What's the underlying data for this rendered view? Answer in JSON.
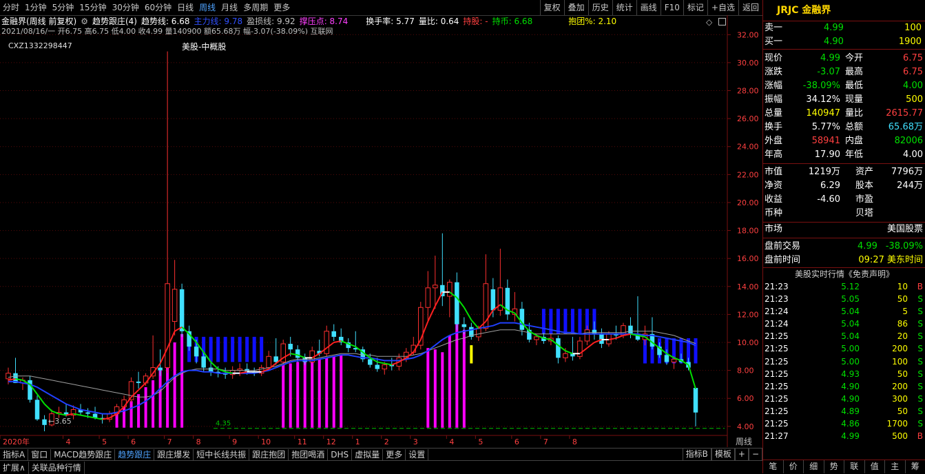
{
  "toolbar": {
    "periods": [
      "分时",
      "1分钟",
      "5分钟",
      "15分钟",
      "30分钟",
      "60分钟",
      "日线",
      "周线",
      "月线",
      "多周期",
      "更多"
    ],
    "active_period": "周线",
    "right_buttons": [
      "复权",
      "叠加",
      "历史",
      "统计",
      "画线",
      "F10",
      "标记",
      "+自选",
      "返回"
    ]
  },
  "info": {
    "stock_line": "金融界(周线 前复权)",
    "indicator_name": "趋势跟庄(4)",
    "trend_label": "趋势线: 6.68",
    "main_label": "主力线: 9.78",
    "profit_label": "盈损线: 9.92",
    "press_label": "撑压点: 8.74",
    "turnover_label": "换手率: 5.77",
    "vol_ratio_label": "量比: 0.64",
    "hold_label": "持股: -",
    "hold_coin_label": "持币: 6.68",
    "group_label": "抱团%: 2.10",
    "ohlc_line": "2021/08/16/一 开6.75 高6.75 低4.00 收4.99 量140900 额65.68万 幅-3.07(-38.09%) 互联网",
    "code": "CXZ1332298447",
    "annotation": "美股-中概股",
    "low_marker": "3.65",
    "support_label": "4.35"
  },
  "chart_data": {
    "type": "candlestick",
    "title": "",
    "xlabel": "",
    "ylabel": "",
    "ylim": [
      3.5,
      33.0
    ],
    "yticks": [
      "32.00",
      "30.00",
      "28.00",
      "26.00",
      "24.00",
      "22.00",
      "20.00",
      "18.00",
      "16.00",
      "14.00",
      "12.00",
      "10.00",
      "8.00",
      "6.00",
      "4.00"
    ],
    "xticks": [
      "2020年",
      "4",
      "5",
      "6",
      "7",
      "8",
      "9",
      "10",
      "11",
      "12",
      "1",
      "2",
      "3",
      "4",
      "5",
      "6",
      "7",
      "8"
    ],
    "period_label": "周线",
    "support_value": 4.35,
    "candles": [
      [
        7.4,
        8.2,
        7.0,
        7.8
      ],
      [
        7.8,
        8.9,
        7.2,
        7.1
      ],
      [
        7.1,
        7.5,
        6.6,
        7.3
      ],
      [
        7.3,
        7.6,
        5.7,
        5.9
      ],
      [
        5.9,
        6.2,
        4.4,
        4.5
      ],
      [
        4.5,
        4.8,
        3.65,
        4.1
      ],
      [
        4.1,
        5.2,
        4.0,
        4.9
      ],
      [
        4.9,
        5.4,
        4.6,
        5.0
      ],
      [
        5.0,
        5.6,
        4.7,
        4.8
      ],
      [
        4.8,
        5.5,
        4.5,
        5.2
      ],
      [
        5.2,
        5.6,
        4.8,
        5.0
      ],
      [
        5.0,
        5.3,
        4.6,
        4.9
      ],
      [
        4.9,
        5.4,
        4.5,
        4.6
      ],
      [
        4.6,
        4.9,
        4.2,
        4.5
      ],
      [
        4.5,
        5.1,
        4.3,
        4.9
      ],
      [
        4.9,
        5.6,
        4.7,
        5.4
      ],
      [
        5.4,
        6.2,
        5.2,
        5.9
      ],
      [
        5.9,
        7.5,
        5.7,
        7.2
      ],
      [
        7.2,
        7.9,
        6.7,
        7.1
      ],
      [
        7.1,
        7.8,
        6.9,
        7.6
      ],
      [
        7.6,
        10.5,
        7.4,
        8.2
      ],
      [
        8.2,
        9.5,
        7.6,
        8.0
      ],
      [
        8.2,
        30.8,
        7.8,
        14.2
      ],
      [
        11.5,
        15.9,
        10.5,
        13.8
      ],
      [
        13.8,
        14.2,
        10.4,
        10.8
      ],
      [
        10.8,
        11.2,
        9.4,
        9.7
      ],
      [
        9.7,
        10.2,
        8.5,
        9.0
      ],
      [
        9.0,
        9.3,
        7.9,
        8.2
      ],
      [
        8.2,
        8.6,
        7.6,
        7.9
      ],
      [
        7.9,
        8.3,
        7.5,
        7.8
      ],
      [
        7.8,
        8.2,
        7.4,
        7.7
      ],
      [
        7.7,
        8.3,
        7.4,
        8.0
      ],
      [
        8.0,
        8.5,
        7.6,
        8.1
      ],
      [
        8.1,
        8.5,
        7.7,
        7.9
      ],
      [
        7.9,
        8.2,
        7.6,
        7.8
      ],
      [
        7.8,
        8.4,
        7.6,
        8.2
      ],
      [
        8.2,
        9.4,
        8.0,
        9.0
      ],
      [
        9.0,
        10.3,
        8.4,
        8.6
      ],
      [
        8.6,
        10.2,
        8.3,
        9.9
      ],
      [
        9.9,
        10.4,
        9.0,
        9.5
      ],
      [
        9.5,
        9.8,
        8.6,
        8.9
      ],
      [
        8.9,
        9.2,
        8.4,
        8.6
      ],
      [
        8.6,
        9.7,
        8.5,
        9.4
      ],
      [
        9.4,
        10.2,
        9.0,
        9.2
      ],
      [
        9.2,
        11.2,
        9.0,
        10.8
      ],
      [
        10.8,
        11.3,
        10.1,
        10.4
      ],
      [
        10.4,
        11.0,
        9.8,
        10.0
      ],
      [
        10.0,
        10.3,
        9.3,
        9.6
      ],
      [
        9.6,
        10.8,
        9.3,
        9.5
      ],
      [
        9.5,
        9.7,
        8.6,
        8.8
      ],
      [
        8.8,
        9.2,
        8.2,
        8.4
      ],
      [
        8.4,
        8.9,
        7.9,
        8.1
      ],
      [
        8.1,
        8.6,
        7.7,
        8.4
      ],
      [
        8.4,
        8.9,
        8.0,
        8.3
      ],
      [
        8.3,
        9.2,
        8.0,
        8.9
      ],
      [
        8.9,
        9.6,
        8.6,
        9.3
      ],
      [
        9.3,
        10.4,
        9.1,
        9.8
      ],
      [
        9.8,
        12.9,
        9.5,
        12.5
      ],
      [
        12.5,
        15.1,
        11.5,
        13.9
      ],
      [
        13.9,
        16.2,
        12.4,
        14.1
      ],
      [
        14.1,
        17.8,
        12.6,
        13.3
      ],
      [
        13.3,
        14.5,
        11.8,
        14.3
      ],
      [
        14.3,
        15.0,
        10.9,
        11.3
      ],
      [
        11.3,
        11.8,
        10.6,
        11.1
      ],
      [
        11.1,
        11.4,
        10.2,
        10.4
      ],
      [
        10.4,
        11.2,
        10.1,
        11.0
      ],
      [
        11.0,
        16.3,
        10.8,
        14.2
      ],
      [
        13.8,
        14.6,
        11.8,
        12.3
      ],
      [
        12.3,
        16.7,
        11.9,
        13.9
      ],
      [
        13.9,
        14.5,
        11.6,
        12.0
      ],
      [
        12.0,
        13.6,
        11.5,
        12.4
      ],
      [
        12.4,
        12.9,
        10.5,
        10.9
      ],
      [
        10.9,
        11.4,
        10.0,
        10.2
      ],
      [
        10.2,
        10.6,
        9.8,
        10.4
      ],
      [
        10.4,
        10.7,
        9.9,
        10.1
      ],
      [
        10.1,
        10.6,
        9.8,
        10.3
      ],
      [
        10.3,
        10.5,
        8.5,
        8.9
      ],
      [
        8.9,
        9.6,
        8.6,
        9.2
      ],
      [
        9.2,
        10.4,
        8.7,
        9.0
      ],
      [
        9.0,
        10.4,
        8.8,
        10.1
      ],
      [
        10.1,
        11.2,
        9.8,
        10.9
      ],
      [
        10.9,
        11.5,
        10.2,
        10.6
      ],
      [
        10.6,
        11.0,
        9.6,
        9.9
      ],
      [
        9.9,
        10.8,
        9.7,
        10.6
      ],
      [
        10.6,
        11.2,
        10.2,
        10.5
      ],
      [
        10.5,
        11.4,
        10.3,
        11.2
      ],
      [
        11.2,
        11.8,
        10.3,
        10.6
      ],
      [
        10.6,
        13.3,
        10.1,
        10.2
      ],
      [
        10.2,
        11.2,
        9.8,
        10.6
      ],
      [
        10.6,
        11.8,
        9.5,
        9.7
      ],
      [
        9.7,
        10.0,
        8.9,
        9.1
      ],
      [
        9.1,
        9.5,
        8.4,
        8.6
      ],
      [
        8.6,
        9.0,
        8.1,
        8.8
      ],
      [
        8.8,
        9.2,
        8.5,
        8.6
      ],
      [
        8.6,
        8.9,
        8.0,
        8.2
      ],
      [
        6.75,
        6.75,
        4.0,
        4.99
      ]
    ],
    "trend_line": [
      7.3,
      7.4,
      7.3,
      7.0,
      6.3,
      5.6,
      5.1,
      4.9,
      4.8,
      4.9,
      4.8,
      4.7,
      4.6,
      4.5,
      4.6,
      4.9,
      5.4,
      6.1,
      6.6,
      7.1,
      7.8,
      8.5,
      9.6,
      10.8,
      11.1,
      10.6,
      10.0,
      9.3,
      8.6,
      8.1,
      7.9,
      7.8,
      7.8,
      7.9,
      7.9,
      7.9,
      8.1,
      8.5,
      8.9,
      9.2,
      9.1,
      8.9,
      8.9,
      9.2,
      9.6,
      10.0,
      10.1,
      9.9,
      9.7,
      9.3,
      8.9,
      8.6,
      8.5,
      8.4,
      8.6,
      8.9,
      9.3,
      10.2,
      11.5,
      12.6,
      13.6,
      13.6,
      13.2,
      12.5,
      11.6,
      11.0,
      11.5,
      12.3,
      12.7,
      12.3,
      12.1,
      11.4,
      10.8,
      10.5,
      10.3,
      10.2,
      9.8,
      9.4,
      9.2,
      9.2,
      9.6,
      10.0,
      10.2,
      10.2,
      10.3,
      10.5,
      10.6,
      10.5,
      10.4,
      10.0,
      9.6,
      9.2,
      8.9,
      8.7,
      8.4,
      6.68
    ],
    "main_line": [
      7.2,
      7.2,
      7.1,
      7.0,
      6.8,
      6.5,
      6.2,
      5.9,
      5.6,
      5.4,
      5.2,
      5.1,
      5.0,
      4.9,
      4.9,
      5.0,
      5.1,
      5.3,
      5.5,
      5.8,
      6.2,
      6.7,
      7.2,
      7.6,
      7.9,
      8.0,
      8.0,
      7.9,
      7.9,
      7.8,
      7.8,
      7.8,
      7.8,
      7.8,
      7.8,
      7.9,
      8.0,
      8.2,
      8.4,
      8.6,
      8.7,
      8.7,
      8.7,
      8.8,
      8.9,
      9.0,
      9.1,
      9.1,
      9.0,
      8.9,
      8.9,
      8.8,
      8.7,
      8.7,
      8.7,
      8.8,
      8.9,
      9.1,
      9.4,
      9.8,
      10.2,
      10.5,
      10.7,
      10.8,
      10.9,
      11.0,
      11.1,
      11.2,
      11.4,
      11.4,
      11.4,
      11.3,
      11.2,
      11.1,
      11.0,
      10.9,
      10.8,
      10.7,
      10.7,
      10.6,
      10.6,
      10.6,
      10.6,
      10.6,
      10.6,
      10.6,
      10.6,
      10.6,
      10.5,
      10.5,
      10.4,
      10.3,
      10.2,
      10.1,
      10.0,
      9.78
    ],
    "profit_line": [
      7.5,
      7.6,
      7.6,
      7.6,
      7.5,
      7.4,
      7.3,
      7.2,
      7.1,
      7.0,
      6.9,
      6.8,
      6.7,
      6.6,
      6.5,
      6.4,
      6.3,
      6.2,
      6.1,
      6.1,
      6.2,
      6.5,
      7.0,
      7.5,
      7.8,
      8.0,
      8.1,
      8.1,
      8.1,
      8.1,
      8.0,
      8.0,
      8.0,
      8.0,
      8.0,
      8.1,
      8.2,
      8.3,
      8.5,
      8.7,
      8.8,
      8.8,
      8.8,
      8.9,
      9.0,
      9.1,
      9.2,
      9.2,
      9.2,
      9.1,
      9.1,
      9.0,
      9.0,
      9.0,
      9.0,
      9.0,
      9.1,
      9.2,
      9.4,
      9.6,
      9.8,
      10.0,
      10.2,
      10.3,
      10.5,
      10.6,
      10.7,
      10.8,
      10.9,
      10.9,
      10.9,
      10.8,
      10.7,
      10.6,
      10.6,
      10.6,
      10.6,
      10.6,
      10.6,
      10.6,
      10.7,
      10.7,
      10.7,
      10.7,
      10.7,
      10.7,
      10.8,
      10.8,
      10.8,
      10.8,
      10.7,
      10.6,
      10.5,
      10.3,
      10.1,
      9.92
    ],
    "pink_bars": [
      0,
      0,
      0,
      0,
      0,
      0,
      0,
      0,
      0,
      0,
      0,
      0,
      0,
      0,
      0,
      5.1,
      5.4,
      5.8,
      6.3,
      6.8,
      7.3,
      8.0,
      9.0,
      10.0,
      10.6,
      0,
      0,
      0,
      0,
      0,
      0,
      0,
      0,
      0,
      0,
      0,
      0,
      0,
      8.4,
      8.5,
      8.6,
      8.6,
      8.7,
      8.8,
      8.9,
      9.0,
      9.1,
      0,
      0,
      0,
      0,
      0,
      0,
      0,
      0,
      0,
      0,
      0,
      9.6,
      9.5,
      9.3,
      10.5,
      11.8,
      10.9,
      0,
      0,
      0,
      0,
      0,
      0,
      0,
      0,
      0,
      0,
      0,
      0,
      0,
      0,
      0,
      0,
      0,
      0,
      0,
      0,
      0,
      0,
      0,
      0,
      0,
      0,
      0,
      0,
      0,
      0,
      0,
      0
    ],
    "yellow_bars": [
      0,
      0,
      0,
      0,
      0,
      0,
      0,
      0,
      0,
      0,
      0,
      0,
      0,
      0,
      0,
      0,
      0,
      0,
      0,
      0,
      0,
      0,
      0,
      0,
      0,
      0,
      0,
      0,
      0,
      0,
      0,
      0,
      0,
      0,
      0,
      0,
      0,
      0,
      0,
      0,
      0,
      0,
      0,
      0,
      0,
      0,
      0,
      0,
      0,
      0,
      0,
      0,
      0,
      0,
      0,
      0,
      0,
      0,
      0,
      0,
      0,
      0,
      0,
      0,
      9.8,
      0,
      0,
      0,
      0,
      0,
      0,
      0,
      0,
      0,
      0,
      0,
      0,
      0,
      0,
      0,
      0,
      0,
      0,
      0,
      0,
      0,
      0,
      0,
      0,
      0,
      0,
      0,
      0,
      0,
      0,
      0
    ],
    "blue_bars": [
      0,
      0,
      0,
      0,
      0,
      0,
      0,
      0,
      0,
      0,
      0,
      0,
      0,
      0,
      0,
      0,
      0,
      0,
      0,
      0,
      0,
      0,
      0,
      0,
      0,
      10.4,
      10.4,
      10.4,
      10.4,
      10.4,
      10.4,
      10.4,
      10.4,
      10.4,
      10.4,
      10.4,
      0,
      0,
      0,
      0,
      0,
      0,
      0,
      0,
      0,
      0,
      0,
      0,
      0,
      0,
      0,
      0,
      0,
      0,
      0,
      0,
      0,
      0,
      0,
      0,
      0,
      0,
      0,
      0,
      0,
      0,
      0,
      0,
      0,
      0,
      0,
      0,
      0,
      0,
      12.4,
      12.4,
      12.4,
      12.4,
      12.4,
      12.4,
      12.4,
      12.4,
      0,
      0,
      0,
      0,
      0,
      0,
      10.3,
      10.3,
      10.3,
      10.3,
      10.3,
      10.3,
      10.3,
      10.3
    ]
  },
  "panel": {
    "title": "JRJC 金融界",
    "sell1_label": "卖一",
    "sell1_price": "4.99",
    "sell1_vol": "100",
    "buy1_label": "买一",
    "buy1_price": "4.90",
    "buy1_vol": "1900",
    "quote": [
      [
        "现价",
        "4.99",
        "今开",
        "6.75"
      ],
      [
        "涨跌",
        "-3.07",
        "最高",
        "6.75"
      ],
      [
        "涨幅",
        "-38.09%",
        "最低",
        "4.00"
      ],
      [
        "振幅",
        "34.12%",
        "现量",
        "500"
      ],
      [
        "总量",
        "140947",
        "量比",
        "2615.77"
      ],
      [
        "换手",
        "5.77%",
        "总额",
        "65.68万"
      ],
      [
        "外盘",
        "58941",
        "内盘",
        "82006"
      ],
      [
        "年高",
        "17.90",
        "年低",
        "4.00"
      ]
    ],
    "fund": [
      [
        "市值",
        "1219万",
        "资产",
        "7796万"
      ],
      [
        "净资",
        "6.29",
        "股本",
        "244万"
      ],
      [
        "收益",
        "-4.60",
        "市盈",
        ""
      ],
      [
        "币种",
        "",
        "贝塔",
        ""
      ]
    ],
    "market_label": "市场",
    "market_value": "美国股票",
    "pre_label": "盘前交易",
    "pre_price": "4.99",
    "pre_pct": "-38.09%",
    "pre_time_label": "盘前时间",
    "pre_time": "09:27 美东时间",
    "ticker_title": "美股实时行情《免责声明》",
    "ticks": [
      [
        "21:23",
        "5.12",
        "10",
        "B"
      ],
      [
        "21:23",
        "5.05",
        "50",
        "S"
      ],
      [
        "21:24",
        "5.04",
        "5",
        "S"
      ],
      [
        "21:24",
        "5.04",
        "86",
        "S"
      ],
      [
        "21:25",
        "5.04",
        "20",
        "S"
      ],
      [
        "21:25",
        "5.00",
        "200",
        "S"
      ],
      [
        "21:25",
        "5.00",
        "100",
        "S"
      ],
      [
        "21:25",
        "4.93",
        "50",
        "S"
      ],
      [
        "21:25",
        "4.90",
        "200",
        "S"
      ],
      [
        "21:25",
        "4.90",
        "300",
        "S"
      ],
      [
        "21:25",
        "4.89",
        "50",
        "S"
      ],
      [
        "21:25",
        "4.86",
        "1700",
        "S"
      ],
      [
        "21:27",
        "4.99",
        "500",
        "B"
      ]
    ],
    "tabs": [
      "笔",
      "价",
      "细",
      "势",
      "联",
      "值",
      "主",
      "筹"
    ]
  },
  "bottom": {
    "tabs": [
      "指标A",
      "窗口",
      "MACD趋势跟庄",
      "趋势跟庄",
      "跟庄爆发",
      "短中长线共振",
      "跟庄抱团",
      "抱团喝酒",
      "DHS",
      "虚拟量",
      "更多",
      "设置"
    ],
    "active_tab": "趋势跟庄",
    "right": [
      "指标B",
      "模板",
      "+",
      "−"
    ],
    "status": [
      "扩展∧",
      "关联品种行情"
    ]
  }
}
